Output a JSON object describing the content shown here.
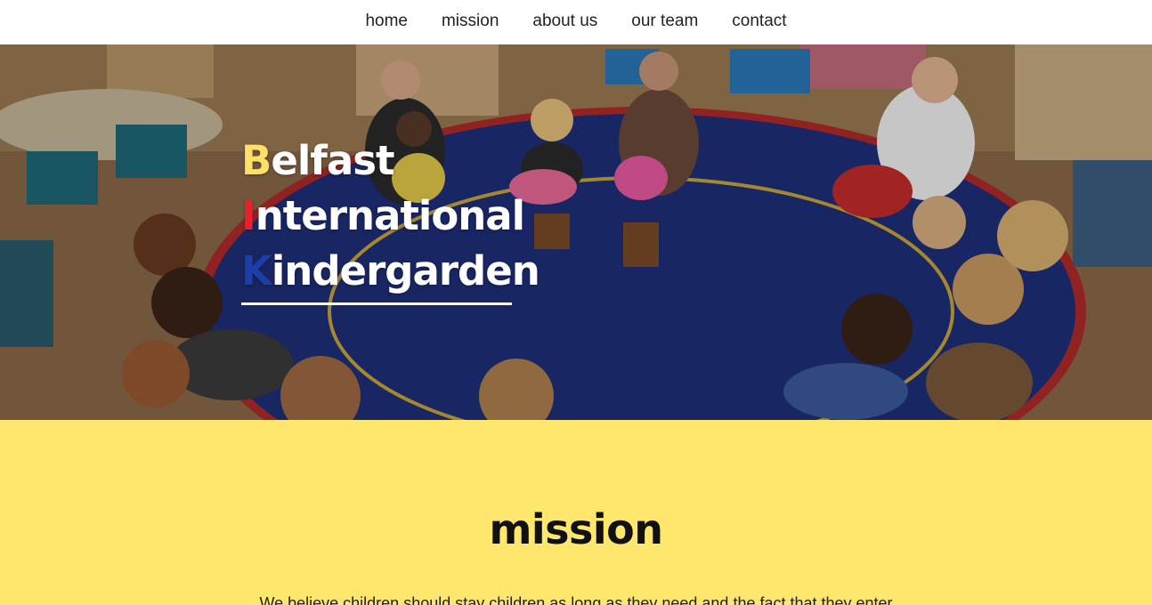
{
  "nav": {
    "items": [
      {
        "label": "home"
      },
      {
        "label": "mission"
      },
      {
        "label": "about us"
      },
      {
        "label": "our team"
      },
      {
        "label": "contact"
      }
    ]
  },
  "hero": {
    "image": "classroom-children-sitting-in-circle-photo",
    "brand": {
      "line1_initial": "B",
      "line1_rest": "elfast",
      "line2_initial": "I",
      "line2_rest": "nternational",
      "line3_initial": "K",
      "line3_rest": "indergarden"
    },
    "colors": {
      "yellow": "#ffe066",
      "red": "#e8212f",
      "blue": "#1d3ea8"
    }
  },
  "mission": {
    "title": "mission",
    "text": "We believe children should stay children as long as they need and the fact that they enter",
    "background": "#ffe76e"
  }
}
